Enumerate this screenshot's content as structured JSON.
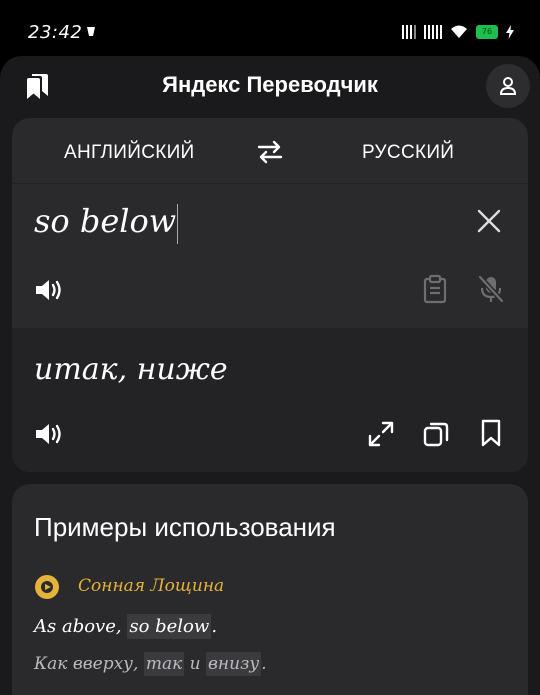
{
  "status_bar": {
    "time": "23:42",
    "battery": "76"
  },
  "header": {
    "title": "Яндекс Переводчик"
  },
  "languages": {
    "source": "АНГЛИЙСКИЙ",
    "target": "РУССКИЙ"
  },
  "input": {
    "text": "so below"
  },
  "output": {
    "text": "итак, ниже"
  },
  "examples": {
    "title": "Примеры использования",
    "items": [
      {
        "source_name": "Сонная Лощина",
        "en_prefix": "As above, ",
        "en_highlight": "so below",
        "en_suffix": ".",
        "ru_prefix": "Как вверху, ",
        "ru_highlight1": "так",
        "ru_middle": " и ",
        "ru_highlight2": "внизу",
        "ru_suffix": "."
      }
    ]
  },
  "colors": {
    "background": "#1a1a1c",
    "card": "#2a2a2d",
    "output_card": "#232326",
    "accent_source": "#e6b33a",
    "battery": "#1fbf4f"
  },
  "icons": {
    "bookmarks": "bookmarks-icon",
    "profile": "profile-icon",
    "swap": "swap-languages-icon",
    "clear": "close-icon",
    "speaker": "speaker-icon",
    "clipboard": "clipboard-icon",
    "mic_off": "mic-off-icon",
    "fullscreen": "fullscreen-icon",
    "copy": "copy-icon",
    "bookmark": "bookmark-icon",
    "source": "film-source-icon"
  }
}
